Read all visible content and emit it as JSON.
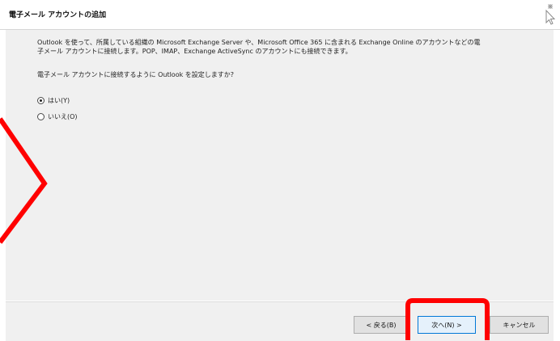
{
  "window": {
    "title": "電子メール アカウントの追加"
  },
  "content": {
    "description_line1": "Outlook を使って、所属している組織の Microsoft Exchange Server や、Microsoft Office 365 に含まれる Exchange Online のアカウントなどの電",
    "description_line2": "子メール アカウントに接続します。POP、IMAP、Exchange ActiveSync のアカウントにも接続できます。",
    "question": "電子メール アカウントに接続するように Outlook を設定しますか?",
    "options": [
      {
        "label": "はい(Y)",
        "selected": true
      },
      {
        "label": "いいえ(O)",
        "selected": false
      }
    ]
  },
  "buttons": {
    "back": "< 戻る(B)",
    "next": "次へ(N) >",
    "cancel": "キャンセル"
  },
  "icons": {
    "header": "sparkle-cursor-icon"
  },
  "colors": {
    "annotation": "#ff0000",
    "focus": "#0078d7",
    "panel": "#f0f0f0"
  }
}
